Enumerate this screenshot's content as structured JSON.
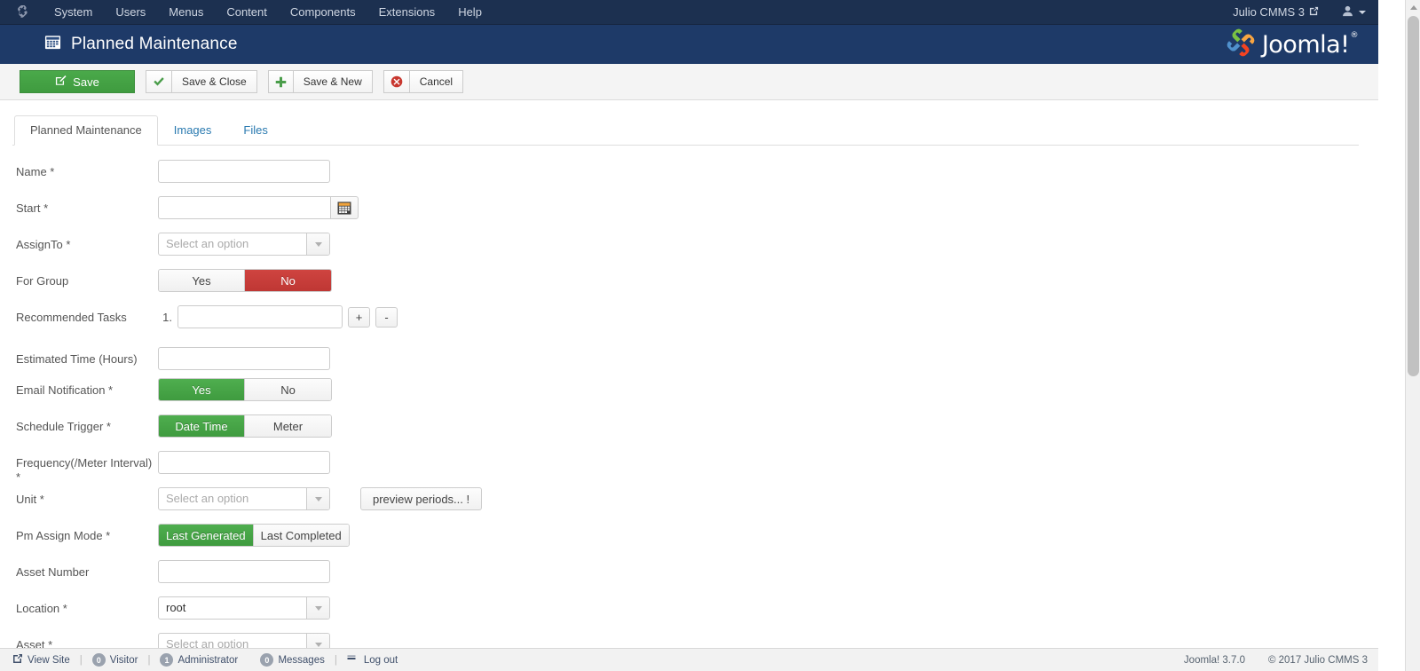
{
  "admin_bar": {
    "brand_icon": "joomla-mark-icon",
    "menu": [
      {
        "label": "System"
      },
      {
        "label": "Users"
      },
      {
        "label": "Menus"
      },
      {
        "label": "Content"
      },
      {
        "label": "Components"
      },
      {
        "label": "Extensions"
      },
      {
        "label": "Help"
      }
    ],
    "site_name": "Julio CMMS 3",
    "site_link_icon": "external-link-icon",
    "user_icon": "user-icon",
    "user_caret_icon": "chevron-down-icon"
  },
  "header": {
    "title": "Planned Maintenance",
    "title_icon": "calendar-icon",
    "logo_text": "Joomla!",
    "logo_registered": "®",
    "logo_icon": "joomla-pinwheel-icon"
  },
  "toolbar": {
    "save_label": "Save",
    "save_icon": "pencil-square-icon",
    "save_close_label": "Save & Close",
    "save_close_icon": "check-icon",
    "save_new_label": "Save & New",
    "save_new_icon": "plus-icon",
    "cancel_label": "Cancel",
    "cancel_icon": "circle-x-icon"
  },
  "tabs": [
    {
      "label": "Planned Maintenance",
      "active": true
    },
    {
      "label": "Images",
      "active": false
    },
    {
      "label": "Files",
      "active": false
    }
  ],
  "form": {
    "name": {
      "label": "Name *",
      "value": "",
      "placeholder": ""
    },
    "start": {
      "label": "Start *",
      "value": "",
      "placeholder": "",
      "calendar_icon": "calendar-picker-icon"
    },
    "assign_to": {
      "label": "AssignTo *",
      "value": "Select an option",
      "is_placeholder": true
    },
    "for_group": {
      "label": "For Group",
      "options": [
        "Yes",
        "No"
      ],
      "selected": "No",
      "selected_color": "#c13e3a"
    },
    "recommended_tasks": {
      "label": "Recommended Tasks",
      "rows": [
        {
          "number": "1.",
          "value": ""
        }
      ],
      "add_label": "+",
      "remove_label": "-"
    },
    "estimated_time": {
      "label": "Estimated Time (Hours)",
      "value": ""
    },
    "email_notification": {
      "label": "Email Notification *",
      "options": [
        "Yes",
        "No"
      ],
      "selected": "Yes",
      "selected_color": "#46a546"
    },
    "schedule_trigger": {
      "label": "Schedule Trigger *",
      "options": [
        "Date Time",
        "Meter"
      ],
      "selected": "Date Time",
      "selected_color": "#46a546"
    },
    "frequency": {
      "label": "Frequency(/Meter Interval) *",
      "value": ""
    },
    "unit": {
      "label": "Unit *",
      "value": "Select an option",
      "is_placeholder": true,
      "preview_label": "preview periods... !"
    },
    "pm_assign_mode": {
      "label": "Pm Assign Mode *",
      "options": [
        "Last Generated",
        "Last Completed"
      ],
      "selected": "Last Generated",
      "selected_color": "#46a546"
    },
    "asset_number": {
      "label": "Asset Number",
      "value": ""
    },
    "location": {
      "label": "Location *",
      "value": "root",
      "is_placeholder": false
    },
    "asset": {
      "label": "Asset *",
      "value": "Select an option",
      "is_placeholder": true
    }
  },
  "status_bar": {
    "view_site": "View Site",
    "view_site_icon": "external-link-icon",
    "visitors_count": "0",
    "visitors_label": "Visitor",
    "admins_count": "1",
    "admins_label": "Administrator",
    "messages_count": "0",
    "messages_label": "Messages",
    "logout_label": "Log out",
    "logout_icon": "logout-icon",
    "version": "Joomla! 3.7.0",
    "copyright": "© 2017 Julio CMMS 3"
  },
  "colors": {
    "admin_bar": "#1c3050",
    "header_bar": "#1e3a68",
    "accent_green": "#46a546",
    "accent_red": "#c13e3a",
    "link_blue": "#2a7ab0"
  }
}
